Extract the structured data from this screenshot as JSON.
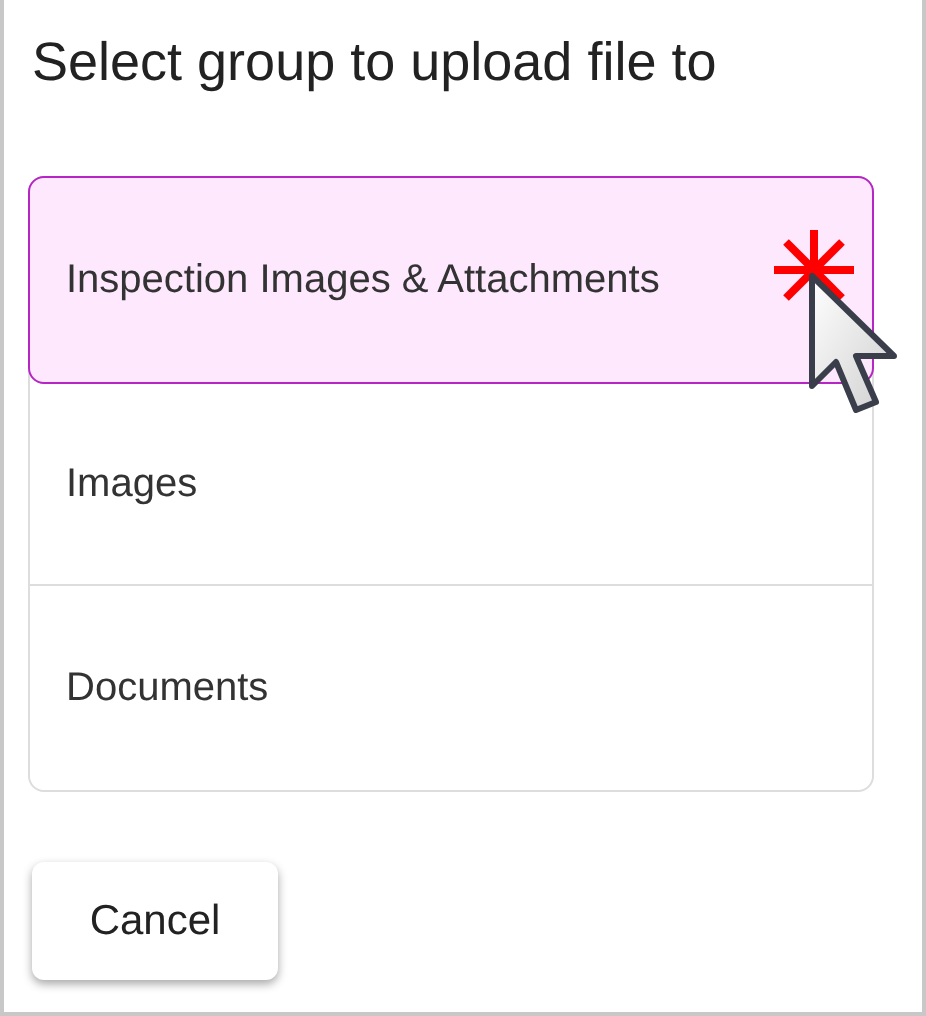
{
  "title": "Select group to upload file to",
  "groups": [
    {
      "label": "Inspection Images & Attachments",
      "selected": true
    },
    {
      "label": "Images",
      "selected": false
    },
    {
      "label": "Documents",
      "selected": false
    }
  ],
  "buttons": [
    "Cancel"
  ]
}
